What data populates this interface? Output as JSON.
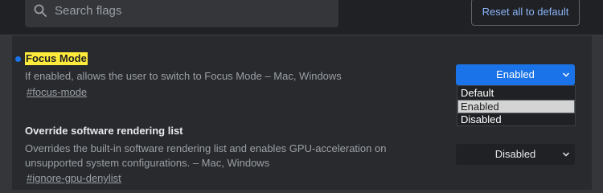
{
  "search": {
    "placeholder": "Search flags",
    "icon": "search-icon"
  },
  "header": {
    "reset_label": "Reset all to default"
  },
  "colors": {
    "accent": "#1a73e8",
    "link": "#8ab4f8",
    "highlight": "#ffeb3b"
  },
  "flags": [
    {
      "title": "Focus Mode",
      "description": "If enabled, allows the user to switch to Focus Mode – Mac, Windows",
      "anchor": "#focus-mode",
      "value": "Enabled",
      "modified": true,
      "dropdown_open": true,
      "options": [
        "Default",
        "Enabled",
        "Disabled"
      ],
      "highlighted_option": "Enabled"
    },
    {
      "title": "Override software rendering list",
      "description": "Overrides the built-in software rendering list and enables GPU-acceleration on unsupported system configurations. – Mac, Windows",
      "anchor": "#ignore-gpu-denylist",
      "value": "Disabled",
      "modified": false
    }
  ]
}
